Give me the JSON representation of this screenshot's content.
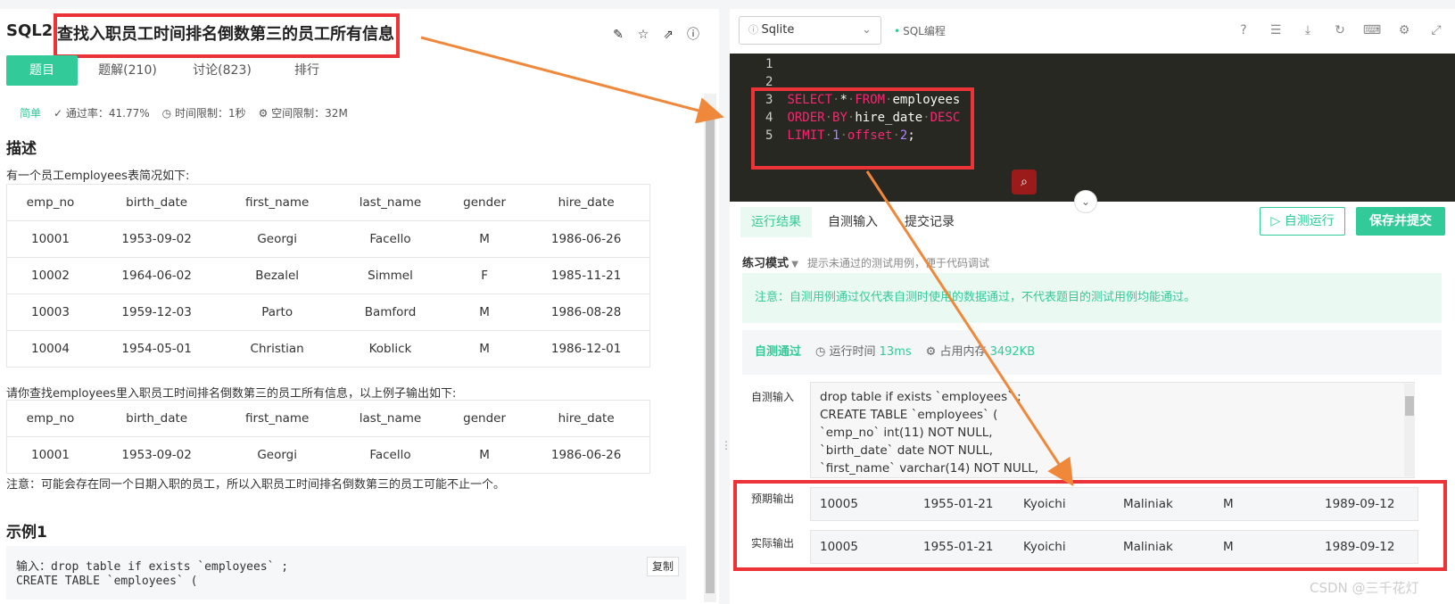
{
  "problem": {
    "id": "SQL2",
    "title": "查找入职员工时间排名倒数第三的员工所有信息",
    "tabs": [
      "题目",
      "题解(210)",
      "讨论(823)",
      "排行"
    ],
    "difficulty": "简单",
    "pass_rate": "通过率：41.77%",
    "time_limit": "时间限制：1秒",
    "space_limit": "空间限制：32M",
    "section_desc": "描述",
    "desc_intro": "有一个员工employees表简况如下:",
    "table_headers": [
      "emp_no",
      "birth_date",
      "first_name",
      "last_name",
      "gender",
      "hire_date"
    ],
    "table_rows": [
      [
        "10001",
        "1953-09-02",
        "Georgi",
        "Facello",
        "M",
        "1986-06-26"
      ],
      [
        "10002",
        "1964-06-02",
        "Bezalel",
        "Simmel",
        "F",
        "1985-11-21"
      ],
      [
        "10003",
        "1959-12-03",
        "Parto",
        "Bamford",
        "M",
        "1986-08-28"
      ],
      [
        "10004",
        "1954-05-01",
        "Christian",
        "Koblick",
        "M",
        "1986-12-01"
      ]
    ],
    "desc_task": "请你查找employees里入职员工时间排名倒数第三的员工所有信息，以上例子输出如下:",
    "output_rows": [
      [
        "10001",
        "1953-09-02",
        "Georgi",
        "Facello",
        "M",
        "1986-06-26"
      ]
    ],
    "note": "注意：可能会存在同一个日期入职的员工，所以入职员工时间排名倒数第三的员工可能不止一个。",
    "section_example": "示例1",
    "example_line1": "输入：drop table if exists  `employees` ;",
    "example_line2": "      CREATE TABLE `employees` (",
    "copy_label": "复制"
  },
  "editor": {
    "language": "Sqlite",
    "tag": "SQL编程",
    "lines": [
      "1",
      "2",
      "3",
      "4",
      "5"
    ],
    "code": {
      "l3_kw1": "SELECT",
      "l3_star": "*",
      "l3_kw2": "FROM",
      "l3_table": "employees",
      "l4_kw1": "ORDER",
      "l4_kw2": "BY",
      "l4_col": "hire_date",
      "l4_kw3": "DESC",
      "l5_kw1": "LIMIT",
      "l5_n1": "1",
      "l5_kw2": "offset",
      "l5_n2": "2",
      "l5_end": ";"
    }
  },
  "result": {
    "tabs": [
      "运行结果",
      "自测输入",
      "提交记录"
    ],
    "run_label": "▷ 自测运行",
    "submit_label": "保存并提交",
    "mode": "练习模式",
    "mode_hint": "提示未通过的测试用例，便于代码调试",
    "notice": "注意：自测用例通过仅代表自测时使用的数据通过，不代表题目的测试用例均能通过。",
    "status": "自测通过",
    "runtime_label": "运行时间",
    "runtime": "13ms",
    "memory_label": "占用内存",
    "memory": "3492KB",
    "input_label": "自测输入",
    "input_lines": [
      "drop table if exists  `employees` ;",
      "CREATE TABLE `employees` (",
      "`emp_no` int(11) NOT NULL,",
      "`birth_date` date NOT NULL,",
      "`first_name` varchar(14) NOT NULL,"
    ],
    "expected_label": "预期输出",
    "actual_label": "实际输出",
    "expected": [
      "10005",
      "1955-01-21",
      "Kyoichi",
      "Maliniak",
      "M",
      "1989-09-12"
    ],
    "actual": [
      "10005",
      "1955-01-21",
      "Kyoichi",
      "Maliniak",
      "M",
      "1989-09-12"
    ]
  },
  "watermark": "CSDN @三千花灯",
  "colors": {
    "accent": "#32ca99",
    "highlight": "#ec3337",
    "arrow": "#f0883c",
    "editor_bg": "#272822"
  }
}
